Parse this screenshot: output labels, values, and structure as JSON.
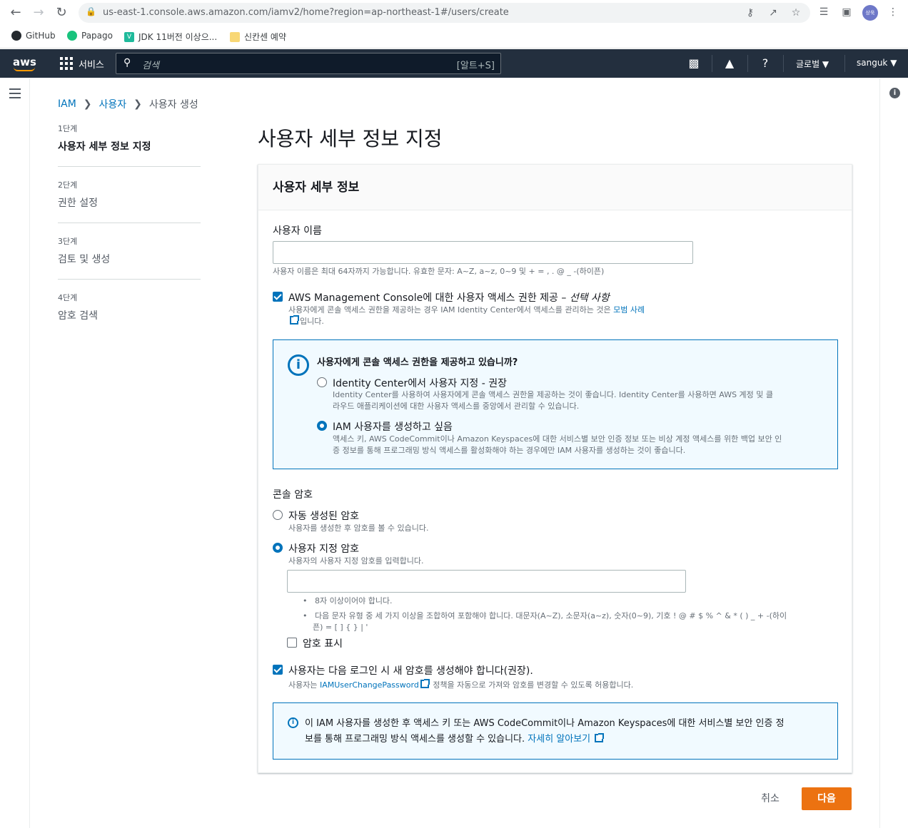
{
  "browser": {
    "url": "us-east-1.console.aws.amazon.com/iamv2/home?region=ap-northeast-1#/users/create",
    "profile_initials": "상욱",
    "bookmarks": [
      "GitHub",
      "Papago",
      "JDK 11버전 이상으...",
      "신칸센 예약"
    ]
  },
  "aws_nav": {
    "logo": "aws",
    "services": "서비스",
    "search_placeholder": "검색",
    "search_shortcut": "[알트+S]",
    "region": "글로벌 ▼",
    "user": "sanguk ▼"
  },
  "breadcrumb": {
    "root": "IAM",
    "parent": "사용자",
    "current": "사용자 생성"
  },
  "steps": [
    {
      "num": "1단계",
      "title": "사용자 세부 정보 지정"
    },
    {
      "num": "2단계",
      "title": "권한 설정"
    },
    {
      "num": "3단계",
      "title": "검토 및 생성"
    },
    {
      "num": "4단계",
      "title": "암호 검색"
    }
  ],
  "page_title": "사용자 세부 정보 지정",
  "panel": {
    "title": "사용자 세부 정보",
    "username_label": "사용자 이름",
    "username_value": "",
    "username_hint": "사용자 이름은 최대 64자까지 가능합니다. 유효한 문자: A~Z, a~z, 0~9 및 + = , . @ _ -(하이픈)",
    "console_access_label": "AWS Management Console에 대한 사용자 액세스 권한 제공 –",
    "console_access_optional": "선택 사항",
    "console_access_desc": "사용자에게 콘솔 액세스 권한을 제공하는 경우 IAM Identity Center에서 액세스를 관리하는 것은",
    "console_access_link": "모범 사례",
    "console_access_desc_end": "입니다.",
    "console_access_checked": true,
    "question_box": {
      "title": "사용자에게 콘솔 액세스 권한을 제공하고 있습니까?",
      "opt1_label": "Identity Center에서 사용자 지정 - 권장",
      "opt1_desc1": "Identity Center를 사용하여 사용자에게 콘솔 액세스 권한을 제공하는 것이 좋습니다. Identity Center를 사용하면 AWS 계정 및 클",
      "opt1_desc2": "라우드 애플리케이션에 대한 사용자 액세스를 중앙에서 관리할 수 있습니다.",
      "opt2_label": "IAM 사용자를 생성하고 싶음",
      "opt2_desc1": "액세스 키, AWS CodeCommit이나 Amazon Keyspaces에 대한 서비스별 보안 인증 정보 또는 비상 계정 액세스를 위한 백업 보안 인",
      "opt2_desc2": "증 정보를 통해 프로그래밍 방식 액세스를 활성화해야 하는 경우에만 IAM 사용자를 생성하는 것이 좋습니다.",
      "selected": "opt2"
    },
    "password_label": "콘솔 암호",
    "pw_auto_label": "자동 생성된 암호",
    "pw_auto_desc": "사용자를 생성한 후 암호를 볼 수 있습니다.",
    "pw_custom_label": "사용자 지정 암호",
    "pw_custom_desc": "사용자의 사용자 지정 암호를 입력합니다.",
    "pw_value": "",
    "pw_selected": "custom",
    "rule1": "8자 이상이어야 합니다.",
    "rule2a": "다음 문자 유형 중 세 가지 이상을 조합하여 포함해야 합니다. 대문자(A~Z), 소문자(a~z), 숫자(0~9), 기호 ! @ # $ % ^ & * ( ) _ + -(하이",
    "rule2b": "픈) = [ ] { } | '",
    "show_pw_label": "암호 표시",
    "show_pw_checked": false,
    "reset_label": "사용자는 다음 로그인 시 새 암호를 생성해야 합니다(권장).",
    "reset_desc_pre": "사용자는",
    "reset_desc_link": "IAMUserChangePassword",
    "reset_desc_post": "정책을 자동으로 가져와 암호를 변경할 수 있도록 허용합니다.",
    "reset_checked": true,
    "note_line1": "이 IAM 사용자를 생성한 후 액세스 키 또는 AWS CodeCommit이나 Amazon Keyspaces에 대한 서비스별 보안 인증 정",
    "note_line2": "보를 통해 프로그래밍 방식 액세스를 생성할 수 있습니다.",
    "note_link": "자세히 알아보기"
  },
  "actions": {
    "cancel": "취소",
    "next": "다음"
  },
  "colors": {
    "nav_bg": "#232f3e",
    "link": "#0073bb",
    "primary_button": "#ec7211",
    "info_bg": "#f1faff"
  }
}
